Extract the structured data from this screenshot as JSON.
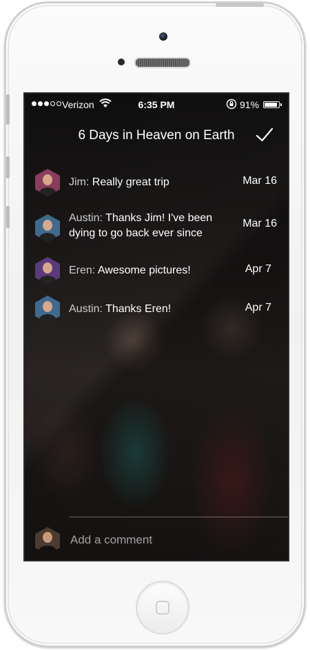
{
  "status_bar": {
    "carrier": "Verizon",
    "time": "6:35 PM",
    "battery": "91%",
    "battery_level": 0.91
  },
  "header": {
    "title": "6 Days in Heaven on Earth",
    "confirm_icon": "checkmark-icon"
  },
  "comments": [
    {
      "author": "Jim:",
      "text": "Really great trip",
      "date": "Mar 16",
      "avatar_color": "#8a3d5c"
    },
    {
      "author": "Austin:",
      "text": "Thanks Jim! I've been dying to go back ever since",
      "date": "Mar 16",
      "avatar_color": "#3f6a8f"
    },
    {
      "author": "Eren:",
      "text": "Awesome pictures!",
      "date": "Apr 7",
      "avatar_color": "#5a3a7a"
    },
    {
      "author": "Austin:",
      "text": "Thanks Eren!",
      "date": "Apr 7",
      "avatar_color": "#3f6a8f"
    }
  ],
  "composer": {
    "placeholder": "Add a comment",
    "avatar_color": "#4a3a30"
  },
  "colors": {
    "text": "#ffffff",
    "author_text": "#cfcfcf",
    "screen_bg": "#0f0d0d"
  }
}
